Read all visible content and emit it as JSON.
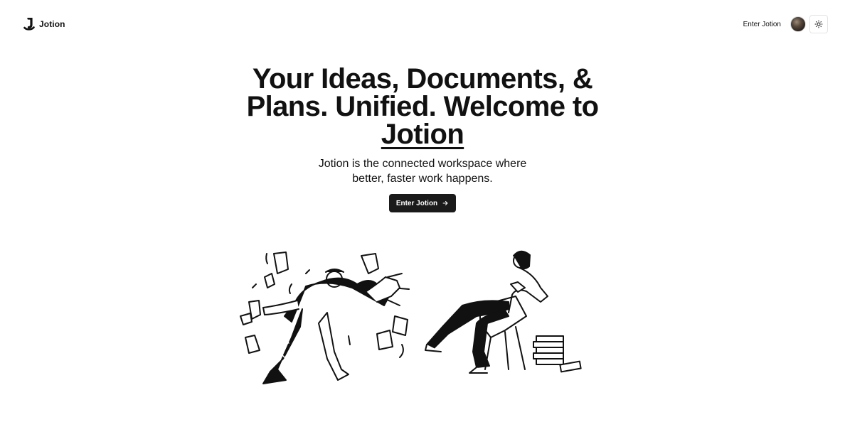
{
  "navbar": {
    "brand_name": "Jotion",
    "enter_label": "Enter Jotion",
    "logo_icon": "jotion-logo-icon",
    "theme_icon": "sun-icon"
  },
  "hero": {
    "headline_main": "Your Ideas, Documents, & Plans. Unified. Welcome to ",
    "headline_brand": "Jotion",
    "subheadline": "Jotion is the connected workspace where better, faster work happens.",
    "cta_label": "Enter Jotion",
    "cta_icon": "arrow-right-icon"
  },
  "colors": {
    "background": "#ffffff",
    "text": "#111111",
    "button_bg": "#1a1a1a",
    "button_text": "#ffffff"
  }
}
